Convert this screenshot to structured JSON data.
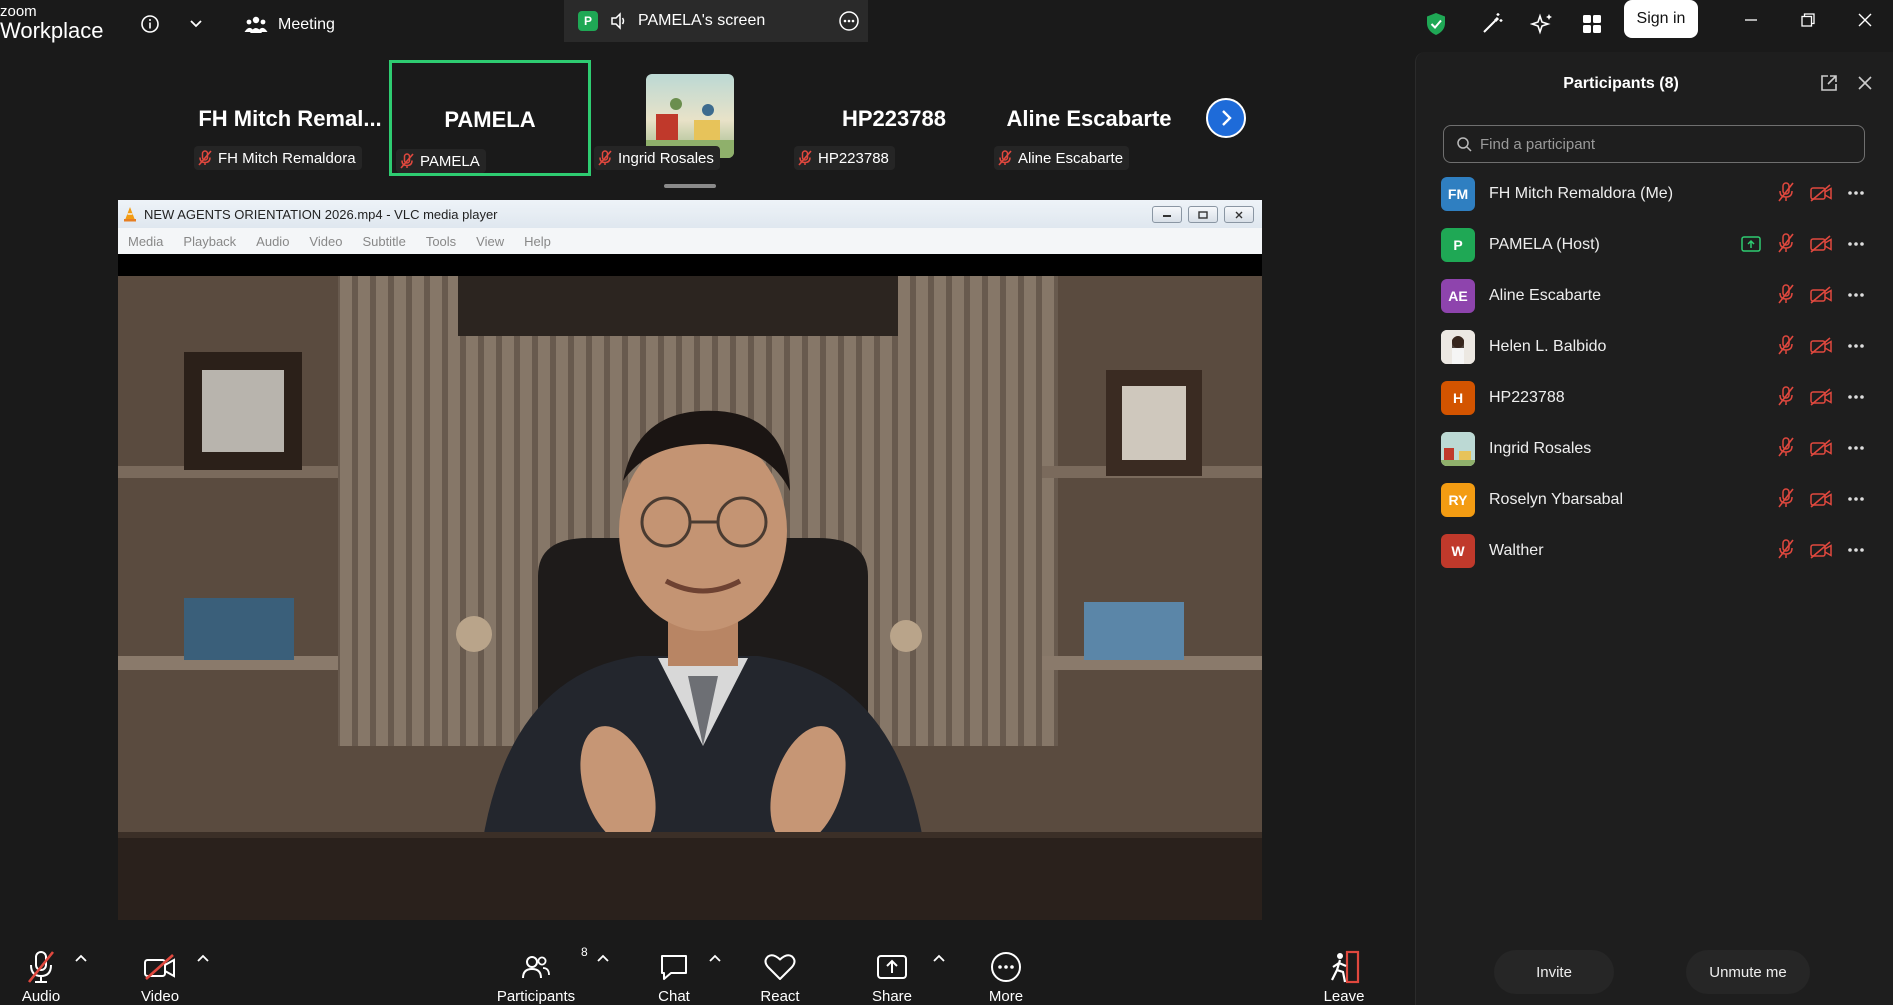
{
  "app": {
    "brand_line1": "zoom",
    "brand_line2": "Workplace"
  },
  "topbar": {
    "meeting_label": "Meeting",
    "screen_badge": "P",
    "screen_label": "PAMELA's screen",
    "signin_label": "Sign in"
  },
  "thumbnails": [
    {
      "big": "FH  Mitch  Remal...",
      "tag": "FH Mitch Remaldora"
    },
    {
      "big": "PAMELA",
      "tag": "PAMELA"
    },
    {
      "big": "",
      "tag": "Ingrid Rosales"
    },
    {
      "big": "HP223788",
      "tag": "HP223788"
    },
    {
      "big": "Aline Escabarte",
      "tag": "Aline Escabarte"
    }
  ],
  "vlc": {
    "title": "NEW AGENTS ORIENTATION 2026.mp4 - VLC media player",
    "menu": [
      "Media",
      "Playback",
      "Audio",
      "Video",
      "Subtitle",
      "Tools",
      "View",
      "Help"
    ]
  },
  "toolbar": {
    "audio": "Audio",
    "video": "Video",
    "participants": "Participants",
    "participants_count": "8",
    "chat": "Chat",
    "react": "React",
    "share": "Share",
    "more": "More",
    "leave": "Leave"
  },
  "panel": {
    "title": "Participants (8)",
    "search_placeholder": "Find a participant",
    "invite": "Invite",
    "unmute": "Unmute me",
    "participants": [
      {
        "initials": "FM",
        "name": "FH Mitch Remaldora (Me)",
        "color": "#2f7fc1"
      },
      {
        "initials": "P",
        "name": "PAMELA (Host)",
        "color": "#1fa855"
      },
      {
        "initials": "AE",
        "name": "Aline Escabarte",
        "color": "#8e44ad"
      },
      {
        "initials": "",
        "name": "Helen L. Balbido",
        "color": "#e9e4dc"
      },
      {
        "initials": "H",
        "name": "HP223788",
        "color": "#d35400"
      },
      {
        "initials": "",
        "name": "Ingrid Rosales",
        "color": "#a8c8a0"
      },
      {
        "initials": "RY",
        "name": "Roselyn Ybarsabal",
        "color": "#f39c12"
      },
      {
        "initials": "W",
        "name": "Walther",
        "color": "#c0392b"
      }
    ]
  },
  "colors": {
    "accent_green": "#2ecc71",
    "mute_red": "#e0483e",
    "next_blue": "#1e6bd9"
  }
}
